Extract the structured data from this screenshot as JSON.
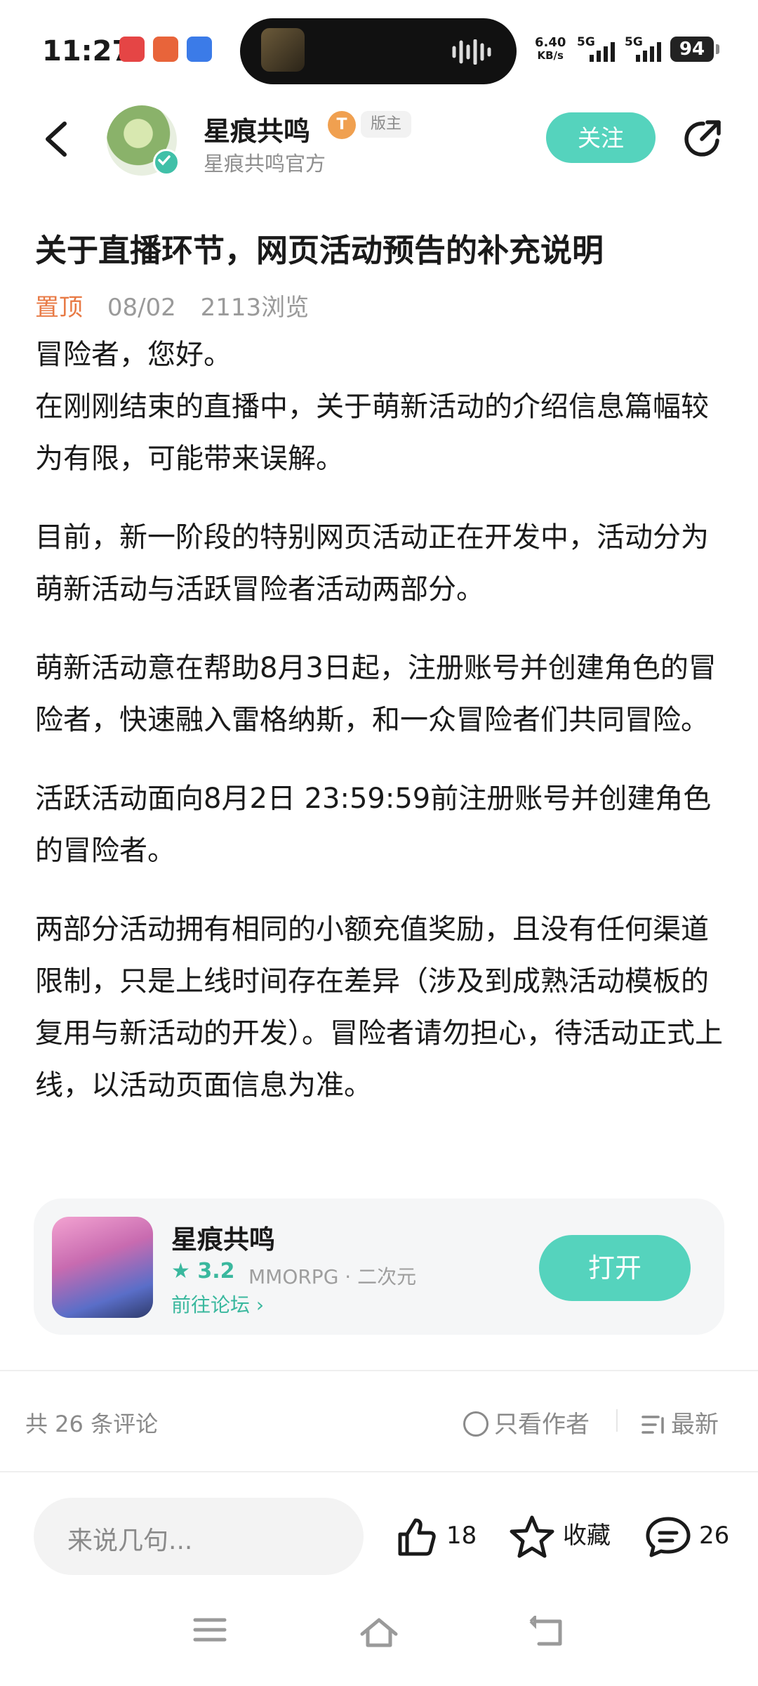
{
  "status_bar": {
    "time": "11:27",
    "net_speed_value": "6.40",
    "net_speed_unit": "KB/s",
    "sig1": "5G",
    "sig2": "5G",
    "battery": "94"
  },
  "header": {
    "author_name": "星痕共鸣",
    "level_badge": "T",
    "role_badge": "版主",
    "author_sub": "星痕共鸣官方",
    "follow_label": "关注",
    "icons": {
      "back": "back-arrow-icon",
      "share": "share-icon"
    }
  },
  "article": {
    "title": "关于直播环节，网页活动预告的补充说明",
    "pin_label": "置顶",
    "date": "08/02",
    "views": "2113浏览",
    "paragraphs": [
      "冒险者，您好。",
      "在刚刚结束的直播中，关于萌新活动的介绍信息篇幅较为有限，可能带来误解。",
      "目前，新一阶段的特别网页活动正在开发中，活动分为萌新活动与活跃冒险者活动两部分。",
      "萌新活动意在帮助8月3日起，注册账号并创建角色的冒险者，快速融入雷格纳斯，和一众冒险者们共同冒险。",
      "活跃活动面向8月2日 23:59:59前注册账号并创建角色的冒险者。",
      "两部分活动拥有相同的小额充值奖励，且没有任何渠道限制，只是上线时间存在差异（涉及到成熟活动模板的复用与新活动的开发）。冒险者请勿担心，待活动正式上线，以活动页面信息为准。"
    ]
  },
  "game_card": {
    "name": "星痕共鸣",
    "rating": "3.2",
    "tags": "MMORPG · 二次元",
    "forum_link": "前往论坛",
    "open_label": "打开"
  },
  "comments_bar": {
    "count_text": "共 26 条评论",
    "only_author": "只看作者",
    "sort": "最新"
  },
  "bottom_bar": {
    "input_placeholder": "来说几句...",
    "likes": "18",
    "collect_label": "收藏",
    "comments": "26"
  },
  "colors": {
    "accent": "#55d3bd",
    "pin": "#e87a45",
    "rating": "#3ab89e"
  }
}
